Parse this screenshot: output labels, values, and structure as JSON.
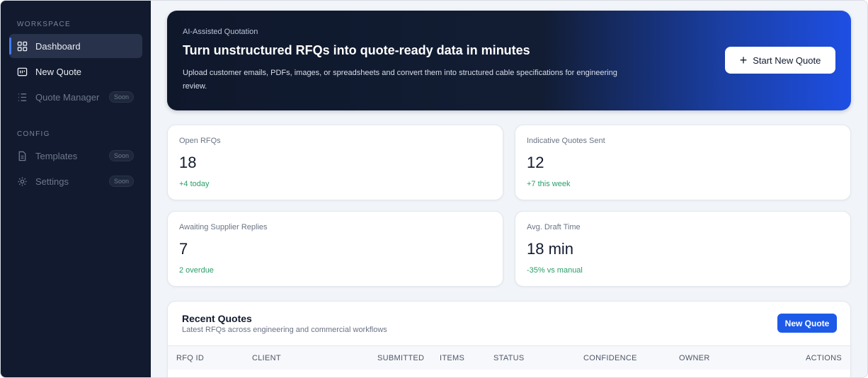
{
  "sidebar": {
    "sections": [
      {
        "label": "WORKSPACE",
        "items": [
          {
            "label": "Dashboard",
            "icon": "grid-icon",
            "active": true
          },
          {
            "label": "New Quote",
            "icon": "inbox-icon"
          },
          {
            "label": "Quote Manager",
            "icon": "list-icon",
            "badge": "Soon"
          }
        ]
      },
      {
        "label": "CONFIG",
        "items": [
          {
            "label": "Templates",
            "icon": "document-icon",
            "badge": "Soon"
          },
          {
            "label": "Settings",
            "icon": "gear-icon",
            "badge": "Soon"
          }
        ]
      }
    ]
  },
  "hero": {
    "eyebrow": "AI-Assisted Quotation",
    "title": "Turn unstructured RFQs into quote-ready data in minutes",
    "description": "Upload customer emails, PDFs, images, or spreadsheets and convert them into structured cable specifications for engineering review.",
    "button_label": "Start New Quote"
  },
  "stats": [
    {
      "label": "Open RFQs",
      "value": "18",
      "delta": "+4 today"
    },
    {
      "label": "Indicative Quotes Sent",
      "value": "12",
      "delta": "+7 this week"
    },
    {
      "label": "Awaiting Supplier Replies",
      "value": "7",
      "delta": "2 overdue"
    },
    {
      "label": "Avg. Draft Time",
      "value": "18 min",
      "delta": "-35% vs manual"
    }
  ],
  "recent_quotes": {
    "title": "Recent Quotes",
    "subtitle": "Latest RFQs across engineering and commercial workflows",
    "button_label": "New Quote",
    "columns": [
      "RFQ ID",
      "CLIENT",
      "SUBMITTED",
      "ITEMS",
      "STATUS",
      "CONFIDENCE",
      "OWNER",
      "ACTIONS"
    ]
  },
  "colors": {
    "sidebar_bg": "#111a2e",
    "accent": "#1d5ae8",
    "positive": "#2a9d6a"
  }
}
